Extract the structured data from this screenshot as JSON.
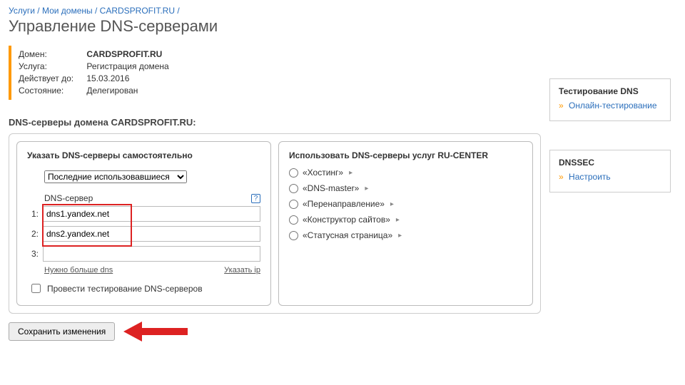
{
  "breadcrumb": {
    "items": [
      "Услуги",
      "Мои домены",
      "CARDSPROFIT.RU"
    ],
    "sep": "/"
  },
  "page_title": "Управление DNS-серверами",
  "info": {
    "rows": [
      {
        "label": "Домен:",
        "value": "CARDSPROFIT.RU",
        "strong": true
      },
      {
        "label": "Услуга:",
        "value": "Регистрация домена"
      },
      {
        "label": "Действует до:",
        "value": "15.03.2016"
      },
      {
        "label": "Состояние:",
        "value": "Делегирован"
      }
    ]
  },
  "section_title": "DNS-серверы домена CARDSPROFIT.RU:",
  "left_panel": {
    "title": "Указать DNS-серверы самостоятельно",
    "select_label": "Последние использовавшиеся",
    "dns_label": "DNS-сервер",
    "help": "?",
    "rows": [
      {
        "num": "1:",
        "value": "dns1.yandex.net"
      },
      {
        "num": "2:",
        "value": "dns2.yandex.net"
      },
      {
        "num": "3:",
        "value": ""
      }
    ],
    "more_link": "Нужно больше dns",
    "ip_link": "Указать ip",
    "test_label": "Провести тестирование DNS-серверов"
  },
  "right_panel": {
    "title": "Использовать DNS-серверы услуг RU-CENTER",
    "options": [
      "«Хостинг»",
      "«DNS-master»",
      "«Перенаправление»",
      "«Конструктор сайтов»",
      "«Статусная страница»"
    ]
  },
  "save_button": "Сохранить изменения",
  "sidebar": {
    "boxes": [
      {
        "title": "Тестирование DNS",
        "link": "Онлайн-тестирование"
      },
      {
        "title": "DNSSEC",
        "link": "Настроить"
      }
    ]
  }
}
